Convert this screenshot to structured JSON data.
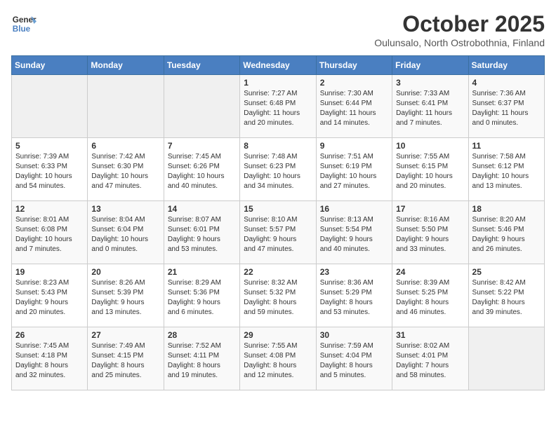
{
  "logo": {
    "line1": "General",
    "line2": "Blue"
  },
  "title": "October 2025",
  "subtitle": "Oulunsalo, North Ostrobothnia, Finland",
  "days_of_week": [
    "Sunday",
    "Monday",
    "Tuesday",
    "Wednesday",
    "Thursday",
    "Friday",
    "Saturday"
  ],
  "weeks": [
    [
      {
        "day": "",
        "info": ""
      },
      {
        "day": "",
        "info": ""
      },
      {
        "day": "",
        "info": ""
      },
      {
        "day": "1",
        "info": "Sunrise: 7:27 AM\nSunset: 6:48 PM\nDaylight: 11 hours\nand 20 minutes."
      },
      {
        "day": "2",
        "info": "Sunrise: 7:30 AM\nSunset: 6:44 PM\nDaylight: 11 hours\nand 14 minutes."
      },
      {
        "day": "3",
        "info": "Sunrise: 7:33 AM\nSunset: 6:41 PM\nDaylight: 11 hours\nand 7 minutes."
      },
      {
        "day": "4",
        "info": "Sunrise: 7:36 AM\nSunset: 6:37 PM\nDaylight: 11 hours\nand 0 minutes."
      }
    ],
    [
      {
        "day": "5",
        "info": "Sunrise: 7:39 AM\nSunset: 6:33 PM\nDaylight: 10 hours\nand 54 minutes."
      },
      {
        "day": "6",
        "info": "Sunrise: 7:42 AM\nSunset: 6:30 PM\nDaylight: 10 hours\nand 47 minutes."
      },
      {
        "day": "7",
        "info": "Sunrise: 7:45 AM\nSunset: 6:26 PM\nDaylight: 10 hours\nand 40 minutes."
      },
      {
        "day": "8",
        "info": "Sunrise: 7:48 AM\nSunset: 6:23 PM\nDaylight: 10 hours\nand 34 minutes."
      },
      {
        "day": "9",
        "info": "Sunrise: 7:51 AM\nSunset: 6:19 PM\nDaylight: 10 hours\nand 27 minutes."
      },
      {
        "day": "10",
        "info": "Sunrise: 7:55 AM\nSunset: 6:15 PM\nDaylight: 10 hours\nand 20 minutes."
      },
      {
        "day": "11",
        "info": "Sunrise: 7:58 AM\nSunset: 6:12 PM\nDaylight: 10 hours\nand 13 minutes."
      }
    ],
    [
      {
        "day": "12",
        "info": "Sunrise: 8:01 AM\nSunset: 6:08 PM\nDaylight: 10 hours\nand 7 minutes."
      },
      {
        "day": "13",
        "info": "Sunrise: 8:04 AM\nSunset: 6:04 PM\nDaylight: 10 hours\nand 0 minutes."
      },
      {
        "day": "14",
        "info": "Sunrise: 8:07 AM\nSunset: 6:01 PM\nDaylight: 9 hours\nand 53 minutes."
      },
      {
        "day": "15",
        "info": "Sunrise: 8:10 AM\nSunset: 5:57 PM\nDaylight: 9 hours\nand 47 minutes."
      },
      {
        "day": "16",
        "info": "Sunrise: 8:13 AM\nSunset: 5:54 PM\nDaylight: 9 hours\nand 40 minutes."
      },
      {
        "day": "17",
        "info": "Sunrise: 8:16 AM\nSunset: 5:50 PM\nDaylight: 9 hours\nand 33 minutes."
      },
      {
        "day": "18",
        "info": "Sunrise: 8:20 AM\nSunset: 5:46 PM\nDaylight: 9 hours\nand 26 minutes."
      }
    ],
    [
      {
        "day": "19",
        "info": "Sunrise: 8:23 AM\nSunset: 5:43 PM\nDaylight: 9 hours\nand 20 minutes."
      },
      {
        "day": "20",
        "info": "Sunrise: 8:26 AM\nSunset: 5:39 PM\nDaylight: 9 hours\nand 13 minutes."
      },
      {
        "day": "21",
        "info": "Sunrise: 8:29 AM\nSunset: 5:36 PM\nDaylight: 9 hours\nand 6 minutes."
      },
      {
        "day": "22",
        "info": "Sunrise: 8:32 AM\nSunset: 5:32 PM\nDaylight: 8 hours\nand 59 minutes."
      },
      {
        "day": "23",
        "info": "Sunrise: 8:36 AM\nSunset: 5:29 PM\nDaylight: 8 hours\nand 53 minutes."
      },
      {
        "day": "24",
        "info": "Sunrise: 8:39 AM\nSunset: 5:25 PM\nDaylight: 8 hours\nand 46 minutes."
      },
      {
        "day": "25",
        "info": "Sunrise: 8:42 AM\nSunset: 5:22 PM\nDaylight: 8 hours\nand 39 minutes."
      }
    ],
    [
      {
        "day": "26",
        "info": "Sunrise: 7:45 AM\nSunset: 4:18 PM\nDaylight: 8 hours\nand 32 minutes."
      },
      {
        "day": "27",
        "info": "Sunrise: 7:49 AM\nSunset: 4:15 PM\nDaylight: 8 hours\nand 25 minutes."
      },
      {
        "day": "28",
        "info": "Sunrise: 7:52 AM\nSunset: 4:11 PM\nDaylight: 8 hours\nand 19 minutes."
      },
      {
        "day": "29",
        "info": "Sunrise: 7:55 AM\nSunset: 4:08 PM\nDaylight: 8 hours\nand 12 minutes."
      },
      {
        "day": "30",
        "info": "Sunrise: 7:59 AM\nSunset: 4:04 PM\nDaylight: 8 hours\nand 5 minutes."
      },
      {
        "day": "31",
        "info": "Sunrise: 8:02 AM\nSunset: 4:01 PM\nDaylight: 7 hours\nand 58 minutes."
      },
      {
        "day": "",
        "info": ""
      }
    ]
  ]
}
